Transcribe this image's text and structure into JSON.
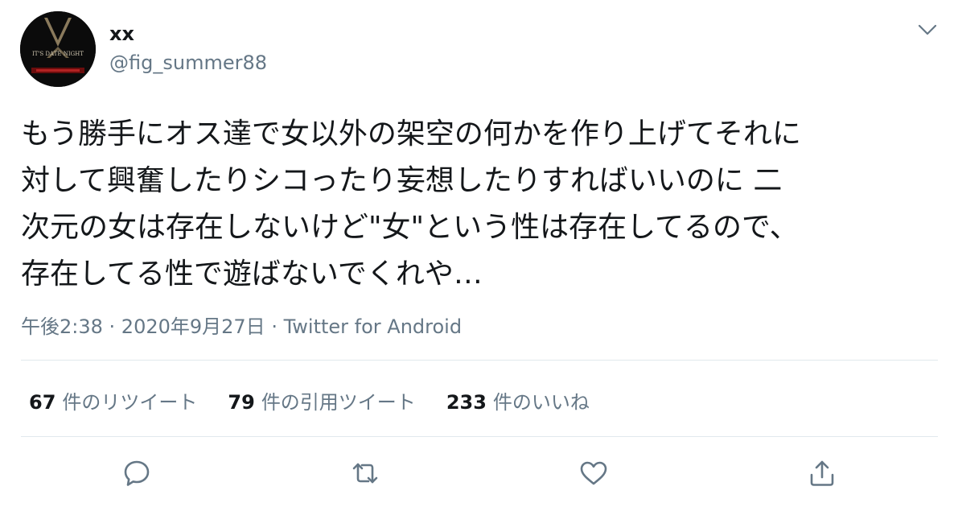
{
  "user": {
    "display_name": "xx",
    "handle": "@fig_summer88",
    "avatar_text": "IT'S DATE NIGHT"
  },
  "tweet": {
    "text": "もう勝手にオス達で女以外の架空の何かを作り上げてそれに\n対して興奮したりシコったり妄想したりすればいいのに 二\n次元の女は存在しないけど\"女\"という性は存在してるので、\n存在してる性で遊ばないでくれや…"
  },
  "meta": {
    "time": "午後2:38",
    "separator1": " · ",
    "date": "2020年9月27日",
    "separator2": " · ",
    "source": "Twitter for Android"
  },
  "stats": {
    "retweets": {
      "count": "67",
      "label": "件のリツイート"
    },
    "quotes": {
      "count": "79",
      "label": "件の引用ツイート"
    },
    "likes": {
      "count": "233",
      "label": "件のいいね"
    }
  },
  "icons": {
    "menu": "chevron-down-icon",
    "reply": "reply-icon",
    "retweet": "retweet-icon",
    "like": "heart-icon",
    "share": "share-icon"
  },
  "colors": {
    "text": "#14171a",
    "secondary": "#657786",
    "divider": "#e1e8ed",
    "avatar_bg": "#0b0b0b"
  }
}
